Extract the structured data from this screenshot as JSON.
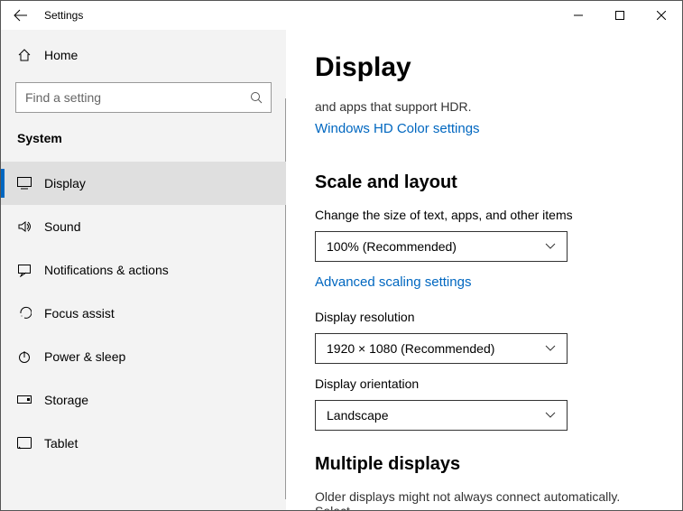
{
  "window": {
    "title": "Settings"
  },
  "sidebar": {
    "home_label": "Home",
    "search_placeholder": "Find a setting",
    "heading": "System",
    "items": [
      {
        "label": "Display"
      },
      {
        "label": "Sound"
      },
      {
        "label": "Notifications & actions"
      },
      {
        "label": "Focus assist"
      },
      {
        "label": "Power & sleep"
      },
      {
        "label": "Storage"
      },
      {
        "label": "Tablet"
      }
    ]
  },
  "content": {
    "page_title": "Display",
    "hdr_note": "and apps that support HDR.",
    "hdr_link": "Windows HD Color settings",
    "scale": {
      "heading": "Scale and layout",
      "size_label": "Change the size of text, apps, and other items",
      "size_value": "100% (Recommended)",
      "advanced_link": "Advanced scaling settings",
      "resolution_label": "Display resolution",
      "resolution_value": "1920 × 1080 (Recommended)",
      "orientation_label": "Display orientation",
      "orientation_value": "Landscape"
    },
    "multiple": {
      "heading": "Multiple displays",
      "note": "Older displays might not always connect automatically. Select"
    }
  }
}
